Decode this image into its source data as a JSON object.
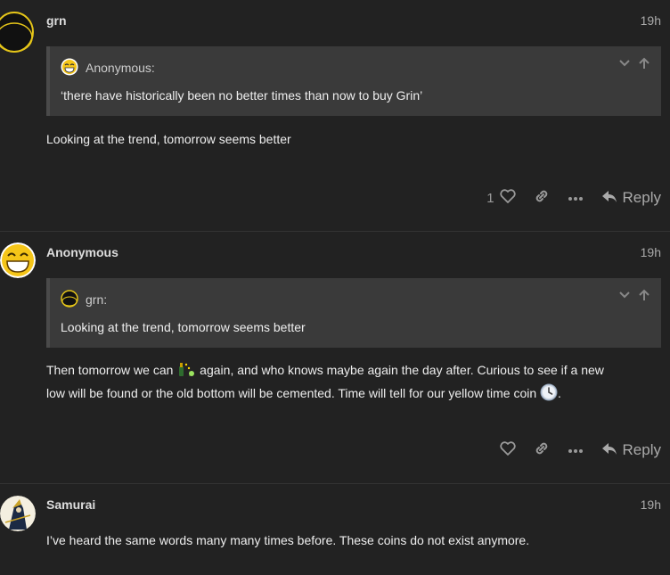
{
  "posts": [
    {
      "username": "grn",
      "time": "19h",
      "quote": {
        "author": "Anonymous:",
        "text": "‘there have historically been no better times than now to buy Grin’"
      },
      "body": "Looking at the trend, tomorrow seems better",
      "likes": "1",
      "reply_label": "Reply"
    },
    {
      "username": "Anonymous",
      "time": "19h",
      "quote": {
        "author": "grn:",
        "text": "Looking at the trend, tomorrow seems better"
      },
      "body_parts": {
        "p1": "Then tomorrow we can ",
        "p2": " again, and who knows maybe again the day after. Curious to see if a new",
        "p3": "low will be found or the old bottom will be cemented. Time will tell for our yellow time coin ",
        "p4": "."
      },
      "reply_label": "Reply"
    },
    {
      "username": "Samurai",
      "time": "19h",
      "body": "I’ve heard the same words many many times before. These coins do not exist anymore."
    }
  ],
  "icons": {
    "heart": "heart-icon",
    "link": "link-icon",
    "more": "more-icon",
    "reply": "reply-icon",
    "expand": "chevron-down-icon",
    "jump": "arrow-up-icon",
    "celebrate": "champagne-icon",
    "clock": "clock-icon"
  },
  "colors": {
    "background": "#222222",
    "quote_bg": "#3a3a3a",
    "accent_yellow": "#e6c619"
  }
}
